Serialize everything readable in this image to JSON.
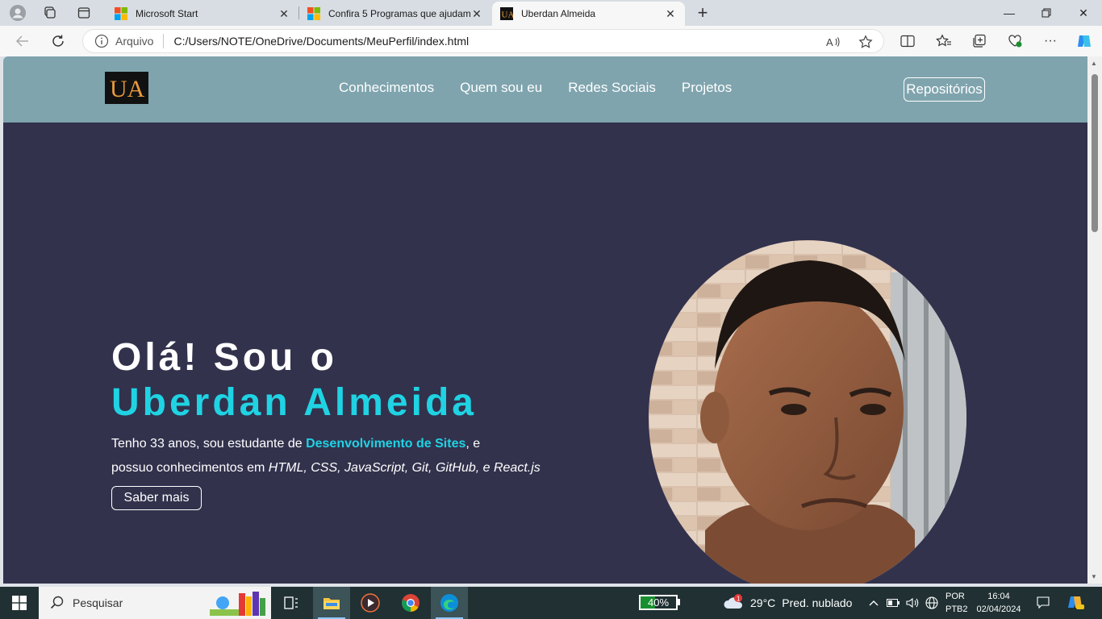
{
  "browser": {
    "tabs": [
      {
        "title": "Microsoft Start",
        "active": false
      },
      {
        "title": "Confira 5 Programas que ajudam",
        "active": false
      },
      {
        "title": "Uberdan Almeida",
        "active": true
      }
    ],
    "address": {
      "security_label": "Arquivo",
      "url": "C:/Users/NOTE/OneDrive/Documents/MeuPerfil/index.html"
    }
  },
  "site": {
    "logo_text": "UA",
    "nav": [
      "Conhecimentos",
      "Quem sou eu",
      "Redes Sociais",
      "Projetos"
    ],
    "repo_button": "Repositórios",
    "hero": {
      "line1": "Olá! Sou o",
      "line2": "Uberdan Almeida",
      "desc_part1": "Tenho 33 anos, sou estudante de ",
      "desc_highlight": "Desenvolvimento de Sites",
      "desc_part2": ", e",
      "desc_part3": "possuo conhecimentos em ",
      "desc_tech": "HTML, CSS, JavaScript, Git, GitHub, e React.js",
      "button": "Saber mais"
    }
  },
  "taskbar": {
    "search_placeholder": "Pesquisar",
    "battery": "40%",
    "battery_level": 0.4,
    "temperature": "29°C",
    "weather": "Pred. nublado",
    "weather_badge": "1",
    "lang_line1": "POR",
    "lang_line2": "PTB2",
    "time": "16:04",
    "date": "02/04/2024"
  },
  "colors": {
    "header_bg": "#7fa4ae",
    "hero_bg": "#32324d",
    "accent": "#1fd3e3"
  }
}
